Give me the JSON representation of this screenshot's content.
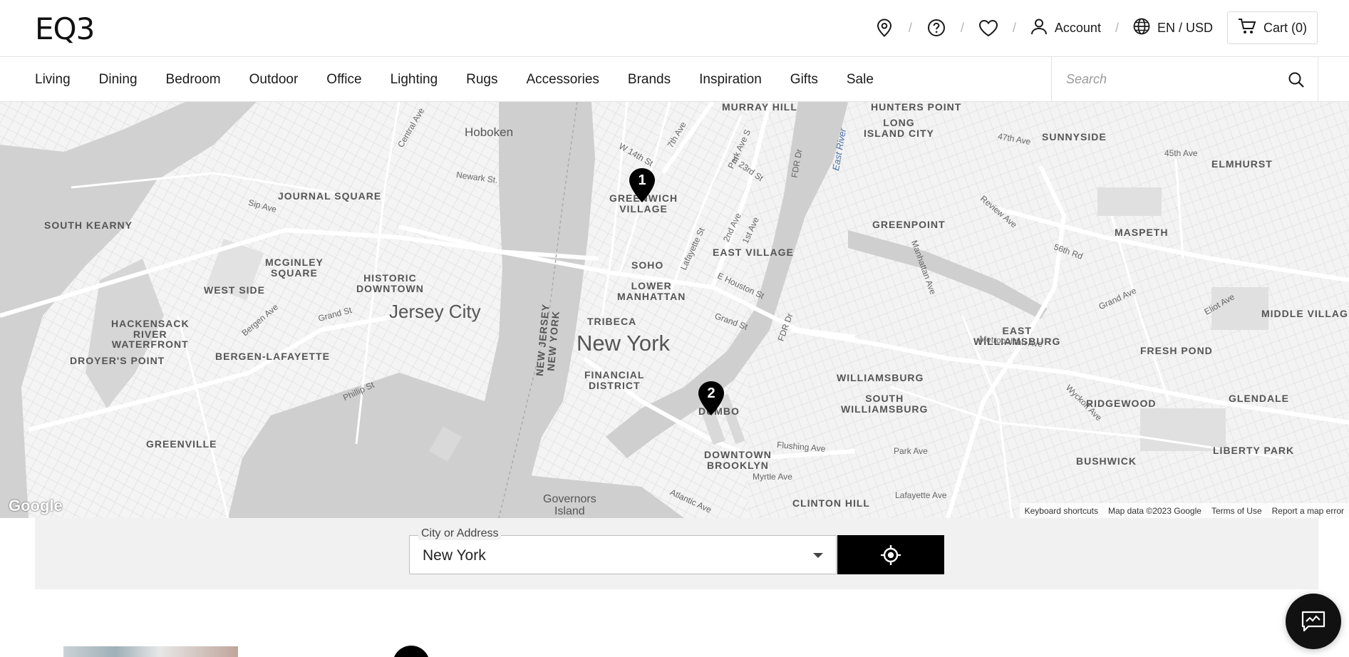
{
  "brand": {
    "logo": "EQ3"
  },
  "header": {
    "icons": [
      "location-pin-icon",
      "help-icon",
      "heart-icon"
    ],
    "account_label": "Account",
    "locale_label": "EN / USD",
    "cart_label": "Cart (0)"
  },
  "nav": {
    "items": [
      "Living",
      "Dining",
      "Bedroom",
      "Outdoor",
      "Office",
      "Lighting",
      "Rugs",
      "Accessories",
      "Brands",
      "Inspiration",
      "Gifts",
      "Sale"
    ],
    "search_placeholder": "Search"
  },
  "map": {
    "labels": {
      "hoboken": "Hoboken",
      "journal_square": "JOURNAL SQUARE",
      "south_kearny": "SOUTH KEARNY",
      "mcginley_square": "MCGINLEY\nSQUARE",
      "west_side": "WEST SIDE",
      "historic_downtown": "HISTORIC\nDOWNTOWN",
      "jersey_city": "Jersey City",
      "hackensack": "HACKENSACK\nRIVER\nWATERFRONT",
      "bergen_lafayette": "BERGEN-LAFAYETTE",
      "droyers_point": "DROYER'S POINT",
      "greenville": "GREENVILLE",
      "greenwich_village": "GREENWICH\nVILLAGE",
      "soho": "SOHO",
      "lower_manhattan": "LOWER\nMANHATTAN",
      "east_village": "EAST VILLAGE",
      "tribeca": "TRIBECA",
      "new_york": "New York",
      "financial_district": "FINANCIAL\nDISTRICT",
      "dumbo": "DUMBO",
      "downtown_brooklyn": "DOWNTOWN\nBROOKLYN",
      "governors_island": "Governors\nIsland",
      "clinton_hill": "CLINTON HILL",
      "murray_hill": "MURRAY HILL",
      "hunters_point": "HUNTERS POINT",
      "long_island_city": "LONG\nISLAND CITY",
      "sunnyside": "SUNNYSIDE",
      "elmhurst": "ELMHURST",
      "maspeth": "MASPETH",
      "greenpoint": "GREENPOINT",
      "east_williamsburg": "EAST\nWILLIAMSBURG",
      "williamsburg": "WILLIAMSBURG",
      "south_williamsburg": "SOUTH\nWILLIAMSBURG",
      "fresh_pond": "FRESH POND",
      "ridgewood": "RIDGEWOOD",
      "glendale": "GLENDALE",
      "middle_village": "MIDDLE VILLAG",
      "bushwick": "BUSHWICK",
      "liberty_park": "LIBERTY PARK",
      "east_river": "East River",
      "new_jersey_new_york": "NEW JERSEY\nNEW YORK",
      "central_ave": "Central Ave",
      "newark_st": "Newark St.",
      "sip_ave": "Sip Ave",
      "grand_st": "Grand St",
      "bergen_ave": "Bergen Ave",
      "phillip_st": "Phillip St",
      "w14th": "W 14th St",
      "seventh_ave": "7th Ave",
      "park_ave_s": "Park Ave S",
      "e23rd": "E 23rd St",
      "fdr_dr": "FDR Dr",
      "lafayette_st": "Lafayette St",
      "second_ave": "2nd Ave",
      "first_ave": "1st Ave",
      "e_houston": "E Houston St",
      "flushing_ave": "Flushing Ave",
      "myrtle_ave": "Myrtle Ave",
      "atlantic_ave": "Atlantic Ave",
      "metropolitan_ave": "Metropolitan Ave",
      "manhattan_ave": "Manhattan Ave",
      "review_ave": "Review Ave",
      "forty_seventh": "47th Ave",
      "forty_fifth": "45th Ave",
      "fifty_sixth_rd": "56th Rd",
      "grand_ave": "Grand Ave",
      "eliot_ave": "Eliot Ave",
      "wyckoff_ave": "Wyckoff Ave",
      "park_ave": "Park Ave",
      "lafayette_ave": "Lafayette Ave"
    },
    "pins": [
      {
        "number": "1"
      },
      {
        "number": "2"
      }
    ],
    "google_logo": "Google",
    "footer": [
      "Keyboard shortcuts",
      "Map data ©2023 Google",
      "Terms of Use",
      "Report a map error"
    ]
  },
  "locator": {
    "field_label": "City or Address",
    "field_value": "New York",
    "locate_button_icon": "crosshair-icon"
  },
  "chat": {
    "icon": "chat-icon"
  }
}
